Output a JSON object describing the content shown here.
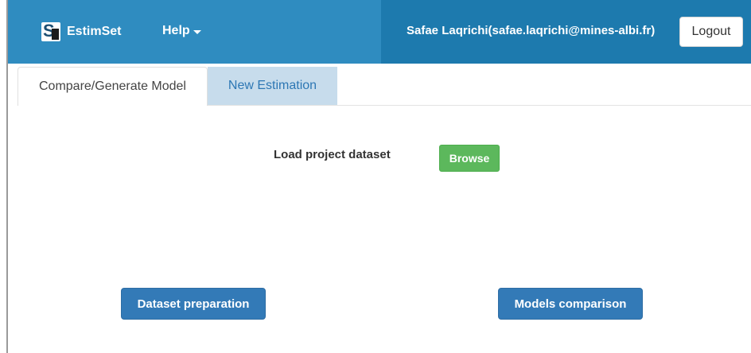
{
  "navbar": {
    "brand_text": "EstimSet",
    "logo_letter": "S",
    "help_label": "Help",
    "user_label": "Safae Laqrichi(safae.laqrichi@mines-albi.fr)",
    "logout_label": "Logout",
    "colors": {
      "navbar_bg": "#2f8cc0",
      "navbar_right_bg": "#1d7aae"
    }
  },
  "tabs": [
    {
      "label": "Compare/Generate Model",
      "active": true
    },
    {
      "label": "New Estimation",
      "active": false
    }
  ],
  "main": {
    "load_label": "Load project dataset",
    "browse_label": "Browse",
    "dataset_preparation_label": "Dataset preparation",
    "models_comparison_label": "Models comparison"
  },
  "icons": {
    "logo": "estimset-logo-icon",
    "help_caret": "caret-down-icon"
  }
}
